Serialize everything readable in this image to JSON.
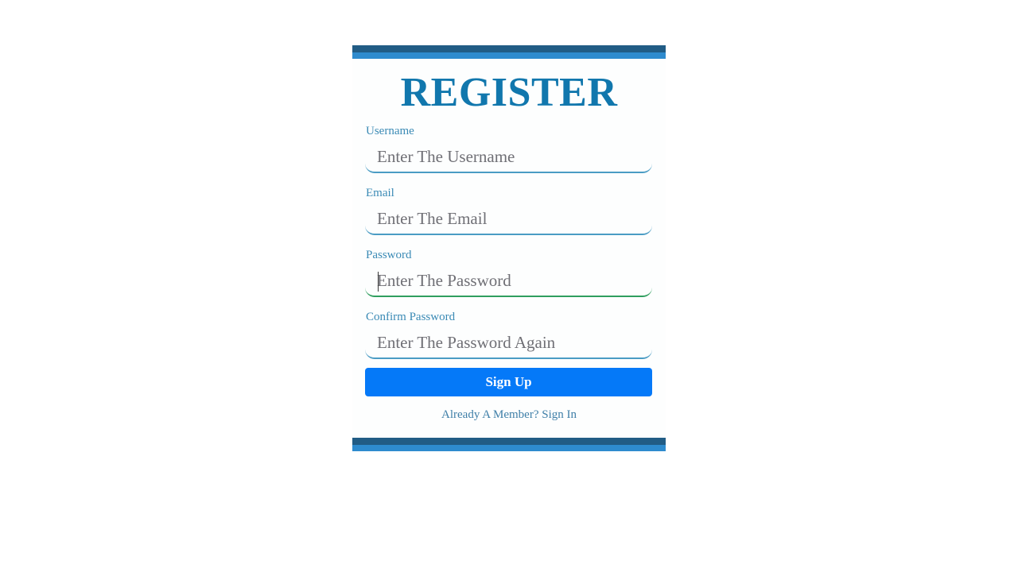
{
  "page": {
    "background_color": "#ffffff"
  },
  "card": {
    "top_bar": {
      "dark_color": "#215c85",
      "light_color": "#2e8bce"
    },
    "bottom_bar": {
      "dark_color": "#215c85",
      "light_color": "#2e8bce"
    },
    "title": "REGISTER",
    "title_color": "#1177ad"
  },
  "form": {
    "fields": [
      {
        "label": "Username",
        "placeholder": "Enter The Username",
        "value": "",
        "type": "text",
        "underline_color": "#4a9cc4",
        "focused": false
      },
      {
        "label": "Email",
        "placeholder": "Enter The Email",
        "value": "",
        "type": "text",
        "underline_color": "#4a9cc4",
        "focused": false
      },
      {
        "label": "Password",
        "placeholder": "Enter The Password",
        "value": "",
        "type": "text",
        "underline_color": "#2f9e5e",
        "focused": true
      },
      {
        "label": "Confirm Password",
        "placeholder": "Enter The Password Again",
        "value": "",
        "type": "text",
        "underline_color": "#4a9cc4",
        "focused": false
      }
    ],
    "label_color": "#3a8ab5",
    "placeholder_color": "#6f6f75"
  },
  "submit": {
    "label": "Sign Up",
    "background_color": "#0579f8",
    "text_color": "#ffffff"
  },
  "footer": {
    "text": "Already A Member? Sign In",
    "color": "#3f7fa8"
  }
}
